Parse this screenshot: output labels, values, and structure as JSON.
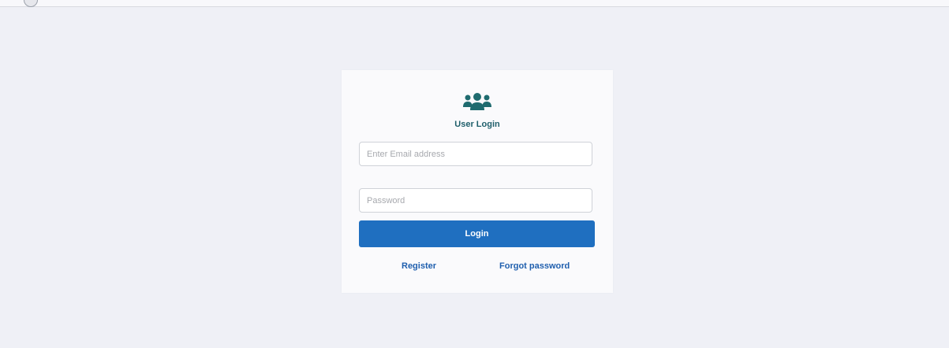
{
  "login": {
    "title": "User Login",
    "email_placeholder": "Enter Email address",
    "password_placeholder": "Password",
    "login_label": "Login",
    "register_label": "Register",
    "forgot_label": "Forgot password"
  },
  "icons": {
    "header": "users-icon"
  },
  "colors": {
    "accent_icon": "#1f6b6f",
    "button": "#1f6fc0",
    "link": "#1f5fae",
    "background": "#eff0f6"
  }
}
